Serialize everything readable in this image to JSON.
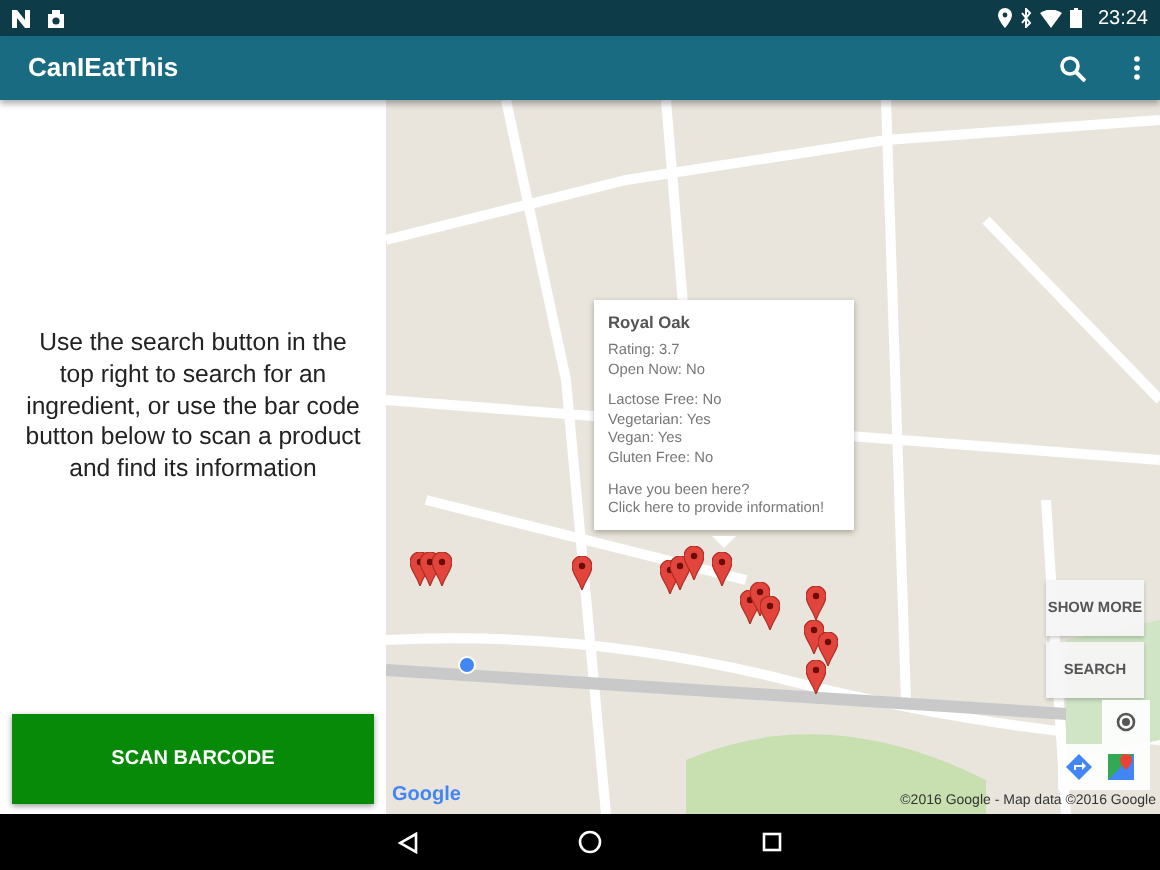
{
  "status_bar": {
    "time": "23:24"
  },
  "app_bar": {
    "title": "CanIEatThis"
  },
  "instructions": "Use the search button in the top right to search for an ingredient, or use the bar code button below to scan a product and find its information",
  "scan_button": "SCAN BARCODE",
  "map": {
    "info_window": {
      "title": "Royal Oak",
      "groups": [
        [
          "Rating: 3.7",
          "Open Now: No"
        ],
        [
          "Lactose Free: No",
          "Vegetarian: Yes",
          "Vegan: Yes",
          "Gluten Free: No"
        ],
        [
          "Have you been here?",
          "Click here to provide information!"
        ]
      ]
    },
    "buttons": [
      "SHOW MORE",
      "SEARCH"
    ],
    "logo": "Google",
    "attribution": "©2016 Google - Map data ©2016 Google"
  }
}
